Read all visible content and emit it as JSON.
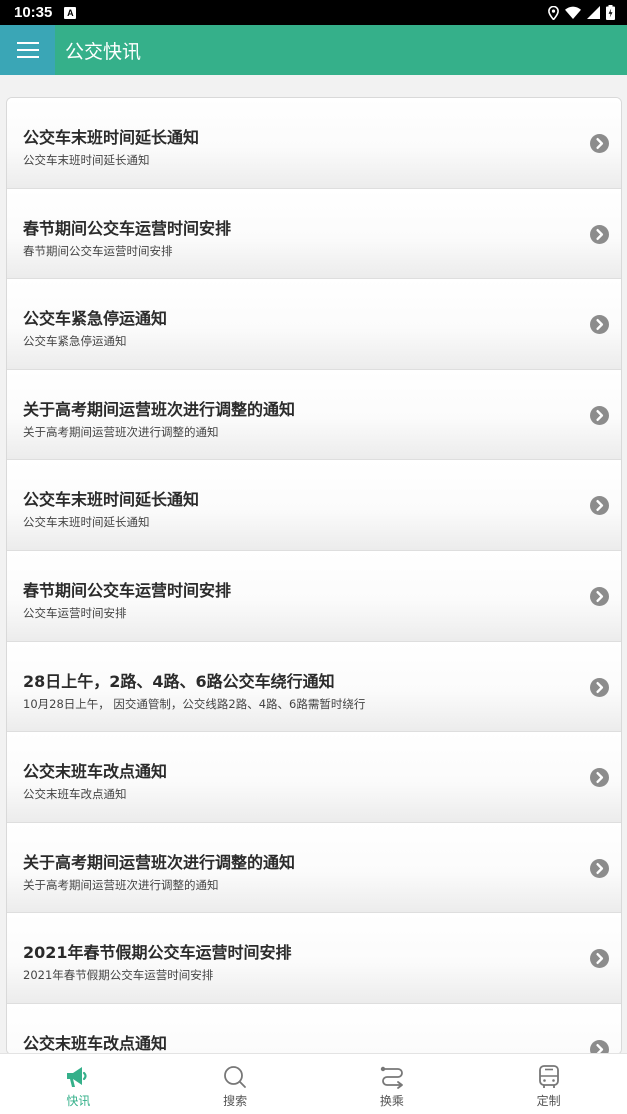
{
  "status_bar": {
    "time": "10:35",
    "notification_letter": "A"
  },
  "header": {
    "title": "公交快讯"
  },
  "news": [
    {
      "title": "公交车末班时间延长通知",
      "subtitle": "公交车末班时间延长通知"
    },
    {
      "title": "春节期间公交车运营时间安排",
      "subtitle": "春节期间公交车运营时间安排"
    },
    {
      "title": "公交车紧急停运通知",
      "subtitle": "公交车紧急停运通知"
    },
    {
      "title": "关于高考期间运营班次进行调整的通知",
      "subtitle": "关于高考期间运营班次进行调整的通知"
    },
    {
      "title": "公交车末班时间延长通知",
      "subtitle": "公交车末班时间延长通知"
    },
    {
      "title": "春节期间公交车运营时间安排",
      "subtitle": "公交车运营时间安排"
    },
    {
      "title": "28日上午，2路、4路、6路公交车绕行通知",
      "subtitle": "10月28日上午， 因交通管制，公交线路2路、4路、6路需暂时绕行"
    },
    {
      "title": "公交末班车改点通知",
      "subtitle": "公交末班车改点通知"
    },
    {
      "title": "关于高考期间运营班次进行调整的通知",
      "subtitle": "关于高考期间运营班次进行调整的通知"
    },
    {
      "title": "2021年春节假期公交车运营时间安排",
      "subtitle": "2021年春节假期公交车运营时间安排"
    },
    {
      "title": "公交末班车改点通知",
      "subtitle": ""
    }
  ],
  "bottom_nav": {
    "items": [
      {
        "label": "快讯",
        "icon": "megaphone-icon",
        "active": true
      },
      {
        "label": "搜索",
        "icon": "search-icon",
        "active": false
      },
      {
        "label": "换乘",
        "icon": "route-icon",
        "active": false
      },
      {
        "label": "定制",
        "icon": "bus-icon",
        "active": false
      }
    ]
  },
  "colors": {
    "primary": "#35b08a",
    "menu_button": "#3aa6b6",
    "chevron": "#8c8c8c",
    "inactive_icon": "#777777"
  }
}
